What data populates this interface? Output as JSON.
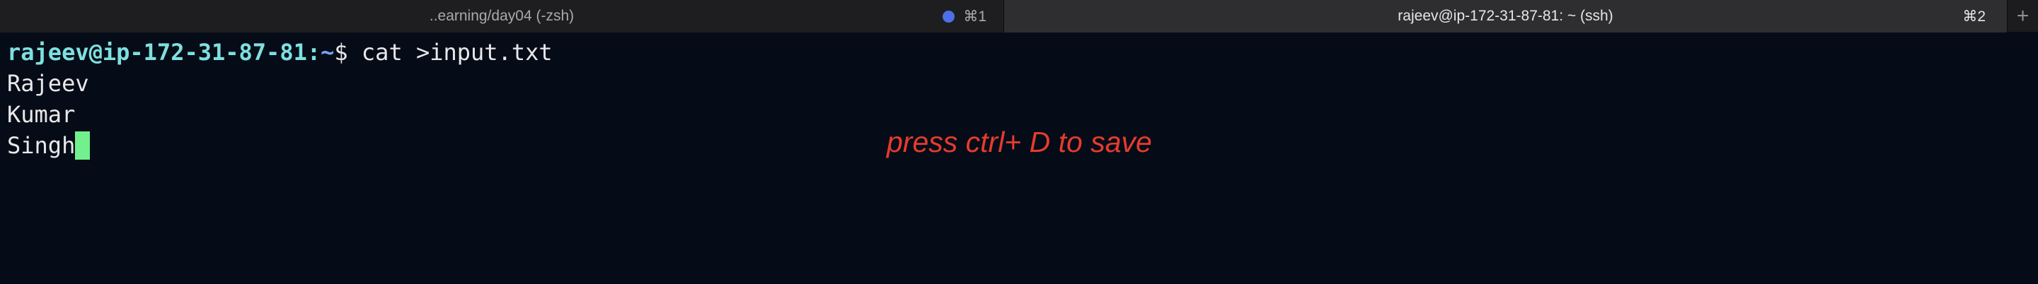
{
  "tabs": [
    {
      "title": "..earning/day04 (-zsh)",
      "shortcut": "⌘1",
      "active": false,
      "has_activity": true
    },
    {
      "title": "rajeev@ip-172-31-87-81: ~ (ssh)",
      "shortcut": "⌘2",
      "active": true
    }
  ],
  "new_tab_symbol": "+",
  "terminal": {
    "prompt_user_host": "rajeev@ip-172-31-87-81",
    "prompt_colon": ":",
    "prompt_path": "~",
    "prompt_symbol": "$",
    "command": " cat >input.txt",
    "lines": [
      "Rajeev",
      "Kumar",
      "Singh"
    ]
  },
  "annotation": "press ctrl+ D to save",
  "colors": {
    "background": "#060c17",
    "prompt_user": "#7ee0e0",
    "prompt_path": "#73a7ff",
    "cursor": "#72f08d",
    "annotation": "#e63b2f",
    "activity_dot": "#4e6fe6"
  }
}
